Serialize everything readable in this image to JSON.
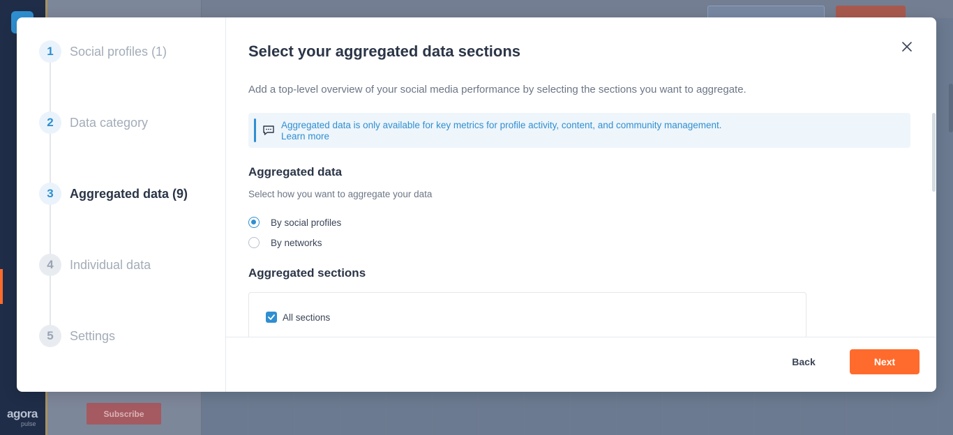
{
  "background": {
    "brand": "agora",
    "brand_sub": "pulse",
    "subscribe_label": "Subscribe"
  },
  "stepper": {
    "steps": [
      {
        "number": "1",
        "label": "Social profiles (1)",
        "state": "done"
      },
      {
        "number": "2",
        "label": "Data category",
        "state": "done"
      },
      {
        "number": "3",
        "label": "Aggregated data (9)",
        "state": "active"
      },
      {
        "number": "4",
        "label": "Individual data",
        "state": "upcoming"
      },
      {
        "number": "5",
        "label": "Settings",
        "state": "upcoming"
      }
    ]
  },
  "main": {
    "title": "Select your aggregated data sections",
    "intro": "Add a top-level overview of your social media performance by selecting the sections you want to aggregate.",
    "info": {
      "message": "Aggregated data is only available for key metrics for profile activity, content, and community management.",
      "link": "Learn more",
      "icon": "chat-icon"
    },
    "aggregated_data": {
      "heading": "Aggregated data",
      "subheading": "Select how you want to aggregate your data",
      "options": [
        {
          "label": "By social profiles",
          "selected": true
        },
        {
          "label": "By networks",
          "selected": false
        }
      ]
    },
    "aggregated_sections": {
      "heading": "Aggregated sections",
      "all_sections_label": "All sections",
      "all_sections_checked": true
    }
  },
  "footer": {
    "back_label": "Back",
    "next_label": "Next"
  },
  "colors": {
    "accent": "#2f8fd1",
    "primary_button": "#ff6b2c",
    "text_dark": "#2b3547"
  }
}
